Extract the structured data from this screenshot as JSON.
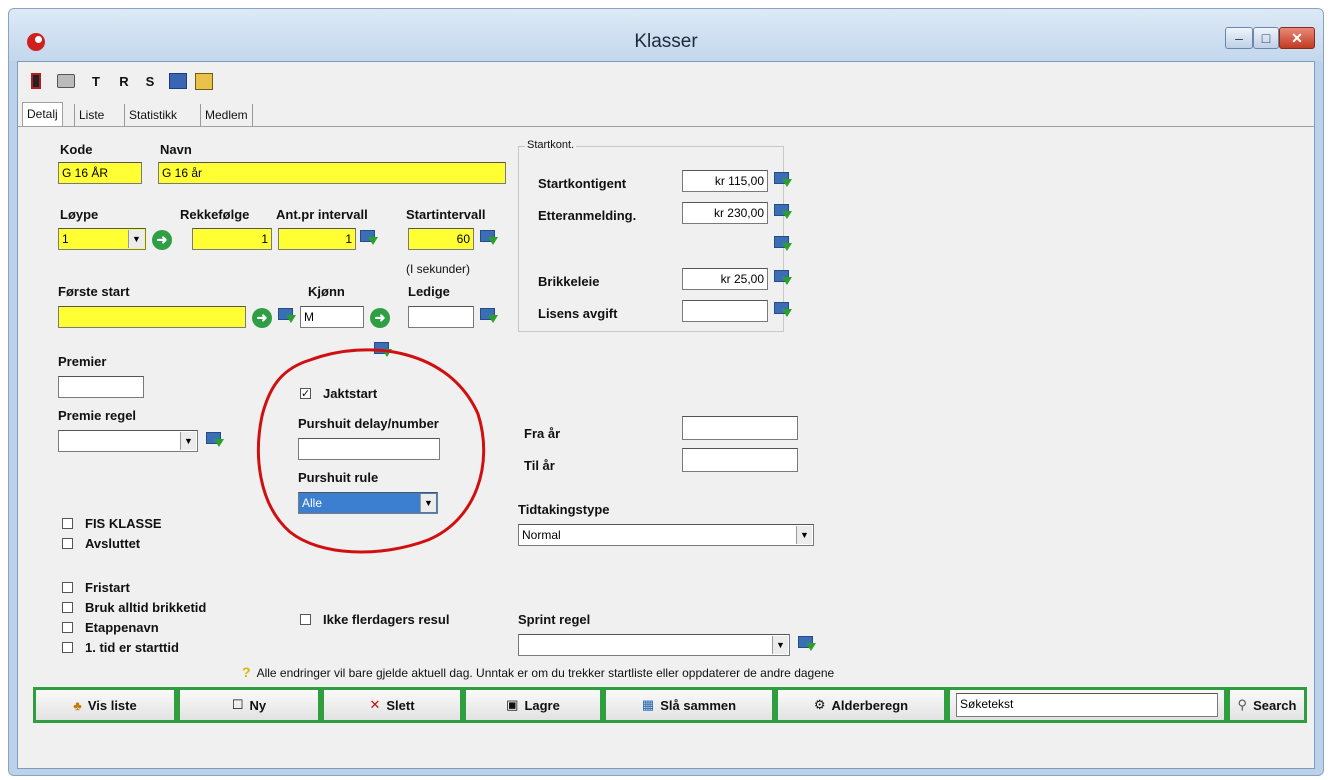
{
  "window": {
    "title": "Klasser",
    "minimize": "–",
    "maximize": "□",
    "close": "✕"
  },
  "toolbar": {
    "t": "T",
    "r": "R",
    "s": "S"
  },
  "tabs": [
    "Detalj",
    "Liste",
    "Statistikk",
    "Medlem"
  ],
  "form": {
    "kode_label": "Kode",
    "kode_value": "G 16 ÅR",
    "navn_label": "Navn",
    "navn_value": "G 16 år",
    "loype_label": "Løype",
    "loype_value": "1",
    "rekkefolge_label": "Rekkefølge",
    "rekkefolge_value": "1",
    "antpr_label": "Ant.pr intervall",
    "antpr_value": "1",
    "startintervall_label": "Startintervall",
    "startintervall_value": "60",
    "sekunder_note": "(I sekunder)",
    "forste_start_label": "Første start",
    "forste_start_value": "",
    "kjonn_label": "Kjønn",
    "kjonn_value": "M",
    "ledige_label": "Ledige",
    "ledige_value": "",
    "premier_label": "Premier",
    "premier_value": "",
    "premie_regel_label": "Premie regel",
    "premie_regel_value": ""
  },
  "startkont": {
    "group_title": "Startkont.",
    "rows": [
      {
        "label": "Startkontigent",
        "value": "kr 115,00"
      },
      {
        "label": "Etteranmelding.",
        "value": "kr 230,00"
      },
      {
        "label": "Brikkeleie",
        "value": "kr 25,00"
      },
      {
        "label": "Lisens avgift",
        "value": ""
      }
    ]
  },
  "pursuit": {
    "jaktstart_label": "Jaktstart",
    "jaktstart_checked": true,
    "delay_label": "Purshuit delay/number",
    "delay_value": "",
    "rule_label": "Purshuit rule",
    "rule_value": "Alle"
  },
  "age": {
    "fra_label": "Fra år",
    "fra_value": "",
    "til_label": "Til år",
    "til_value": ""
  },
  "tidtaking": {
    "label": "Tidtakingstype",
    "value": "Normal"
  },
  "checkboxes": {
    "fis": "FIS KLASSE",
    "avsluttet": "Avsluttet",
    "fristart": "Fristart",
    "brikketid": "Bruk alltid brikketid",
    "etappenavn": "Etappenavn",
    "starttid": "1. tid er starttid",
    "flerdagers": "Ikke flerdagers resul"
  },
  "sprint": {
    "label": "Sprint regel",
    "value": ""
  },
  "info_note": "Alle endringer vil bare gjelde aktuell dag. Unntak er om du trekker startliste eller oppdaterer de andre dagene",
  "buttons": {
    "vis_liste": "Vis liste",
    "ny": "Ny",
    "slett": "Slett",
    "lagre": "Lagre",
    "sla_sammen": "Slå sammen",
    "alderberegn": "Alderberegn",
    "search": "Search"
  },
  "search": {
    "value": "Søketekst"
  },
  "colors": {
    "required_field": "#ffff33",
    "button_border": "#2e9e3e",
    "annotation": "#d01010"
  }
}
